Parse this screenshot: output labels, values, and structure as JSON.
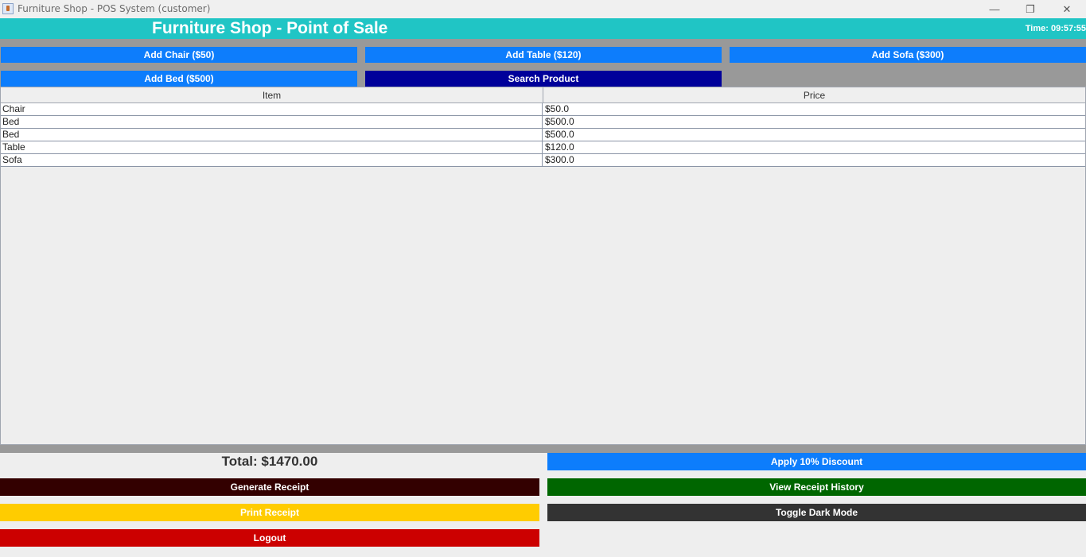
{
  "window": {
    "title": "Furniture Shop - POS System (customer)",
    "minimize_glyph": "—",
    "restore_glyph": "❐",
    "close_glyph": "✕"
  },
  "header": {
    "title": "Furniture Shop - Point of Sale",
    "clock": "Time: 09:57:55"
  },
  "toolbar": {
    "add_chair": "Add Chair ($50)",
    "add_table": "Add Table ($120)",
    "add_sofa": "Add Sofa ($300)",
    "add_bed": "Add Bed ($500)",
    "search": "Search Product"
  },
  "table": {
    "columns": [
      "Item",
      "Price"
    ],
    "rows": [
      {
        "item": "Chair",
        "price": "$50.0"
      },
      {
        "item": "Bed",
        "price": "$500.0"
      },
      {
        "item": "Bed",
        "price": "$500.0"
      },
      {
        "item": "Table",
        "price": "$120.0"
      },
      {
        "item": "Sofa",
        "price": "$300.0"
      }
    ]
  },
  "footer": {
    "total": "Total: $1470.00",
    "apply_discount": "Apply 10% Discount",
    "generate_receipt": "Generate Receipt",
    "view_history": "View Receipt History",
    "print_receipt": "Print Receipt",
    "toggle_dark": "Toggle Dark Mode",
    "logout": "Logout"
  },
  "colors": {
    "header": "#20c5c5",
    "primary_blue": "#0d7dfc",
    "navy": "#00009a",
    "dark_red": "#330000",
    "green": "#006600",
    "yellow": "#ffcc00",
    "charcoal": "#333333",
    "red": "#cc0000"
  }
}
